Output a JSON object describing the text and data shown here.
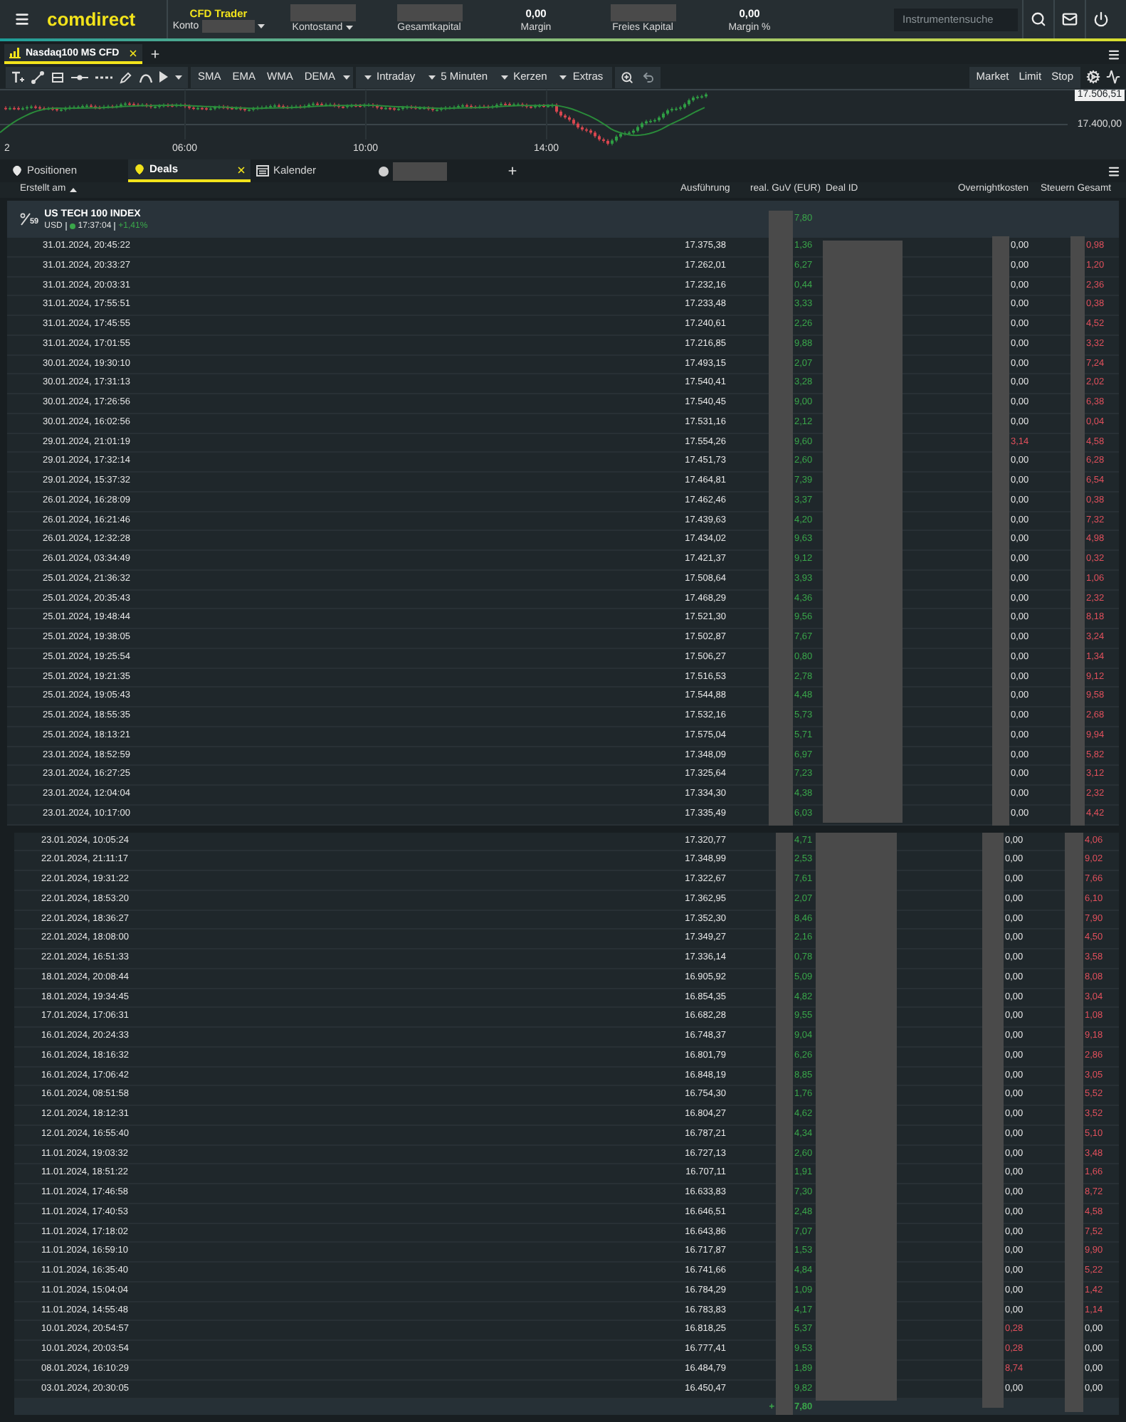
{
  "top_bar": {
    "logo": "comdirect",
    "account": {
      "product": "CFD Trader",
      "label": "Konto",
      "redacted": true
    },
    "stats": [
      {
        "label": "Kontostand",
        "redacted": true,
        "dropdown": true
      },
      {
        "label": "Gesamtkapital",
        "redacted": true,
        "dropdown": false
      },
      {
        "value": "0,00",
        "label": "Margin",
        "redacted": false,
        "dropdown": false
      },
      {
        "label": "Freies Kapital",
        "redacted": true,
        "dropdown": false
      },
      {
        "value": "0,00",
        "label": "Margin %",
        "redacted": false,
        "dropdown": false
      }
    ],
    "search": {
      "placeholder": "Instrumentensuche"
    }
  },
  "instrument_tabs": [
    {
      "label": "Nasdaq100 MS CFD",
      "selected": true,
      "closable": true
    }
  ],
  "toolbar": {
    "indicators": [
      "SMA",
      "EMA",
      "WMA",
      "DEMA"
    ],
    "dropdowns": [
      "Intraday",
      "5 Minuten",
      "Kerzen",
      "Extras"
    ],
    "order_types": [
      "Market",
      "Limit",
      "Stop"
    ]
  },
  "chart": {
    "price_tag": "17.506,51",
    "price_level": "17.400,00",
    "time_labels": [
      "2",
      "06:00",
      "10:00",
      "14:00"
    ]
  },
  "panel_tabs": [
    {
      "kind": "positions",
      "label": "Positionen",
      "selected": false,
      "closable": false
    },
    {
      "kind": "deals",
      "label": "Deals",
      "selected": true,
      "closable": true
    },
    {
      "kind": "calendar",
      "label": "Kalender",
      "selected": false,
      "closable": false
    },
    {
      "kind": "instrument",
      "redacted": true,
      "selected": false,
      "closable": false
    }
  ],
  "table": {
    "columns": [
      {
        "label": "Erstellt am",
        "sorted": true
      },
      {
        "label": "Ausführung",
        "sorted": false
      },
      {
        "label": "real. GuV (EUR)",
        "sorted": false
      },
      {
        "label": "Deal ID",
        "sorted": false
      },
      {
        "label": "Overnightkosten",
        "sorted": false
      },
      {
        "label": "Steuern Gesamt",
        "sorted": false
      }
    ],
    "group": {
      "badge": "59",
      "name": "US TECH 100 INDEX",
      "currency": "USD",
      "time": "17:37:04",
      "change": "+1,41%",
      "total": "7,80"
    },
    "sections": [
      {
        "redacted": true,
        "rows": [
          {
            "created": "31.01.2024, 20:45:22",
            "execution": "17.375,38",
            "pnl": "1,36",
            "overnight": "0,00",
            "overnight_debit": false,
            "taxes": "0,98",
            "taxes_debit": true
          },
          {
            "created": "31.01.2024, 20:33:27",
            "execution": "17.262,01",
            "pnl": "6,27",
            "overnight": "0,00",
            "overnight_debit": false,
            "taxes": "1,20",
            "taxes_debit": true
          },
          {
            "created": "31.01.2024, 20:03:31",
            "execution": "17.232,16",
            "pnl": "0,44",
            "overnight": "0,00",
            "overnight_debit": false,
            "taxes": "2,36",
            "taxes_debit": true
          },
          {
            "created": "31.01.2024, 17:55:51",
            "execution": "17.233,48",
            "pnl": "3,33",
            "overnight": "0,00",
            "overnight_debit": false,
            "taxes": "0,38",
            "taxes_debit": true
          },
          {
            "created": "31.01.2024, 17:45:55",
            "execution": "17.240,61",
            "pnl": "2,26",
            "overnight": "0,00",
            "overnight_debit": false,
            "taxes": "4,52",
            "taxes_debit": true
          },
          {
            "created": "31.01.2024, 17:01:55",
            "execution": "17.216,85",
            "pnl": "9,88",
            "overnight": "0,00",
            "overnight_debit": false,
            "taxes": "3,32",
            "taxes_debit": true
          },
          {
            "created": "30.01.2024, 19:30:10",
            "execution": "17.493,15",
            "pnl": "2,07",
            "overnight": "0,00",
            "overnight_debit": false,
            "taxes": "7,24",
            "taxes_debit": true
          },
          {
            "created": "30.01.2024, 17:31:13",
            "execution": "17.540,41",
            "pnl": "3,28",
            "overnight": "0,00",
            "overnight_debit": false,
            "taxes": "2,02",
            "taxes_debit": true
          },
          {
            "created": "30.01.2024, 17:26:56",
            "execution": "17.540,45",
            "pnl": "9,00",
            "overnight": "0,00",
            "overnight_debit": false,
            "taxes": "6,38",
            "taxes_debit": true
          },
          {
            "created": "30.01.2024, 16:02:56",
            "execution": "17.531,16",
            "pnl": "2,12",
            "overnight": "0,00",
            "overnight_debit": false,
            "taxes": "0,04",
            "taxes_debit": true
          },
          {
            "created": "29.01.2024, 21:01:19",
            "execution": "17.554,26",
            "pnl": "9,60",
            "overnight": "3,14",
            "overnight_debit": true,
            "taxes": "4,58",
            "taxes_debit": true
          },
          {
            "created": "29.01.2024, 17:32:14",
            "execution": "17.451,73",
            "pnl": "2,60",
            "overnight": "0,00",
            "overnight_debit": false,
            "taxes": "6,28",
            "taxes_debit": true
          },
          {
            "created": "29.01.2024, 15:37:32",
            "execution": "17.464,81",
            "pnl": "7,39",
            "overnight": "0,00",
            "overnight_debit": false,
            "taxes": "6,54",
            "taxes_debit": true
          },
          {
            "created": "26.01.2024, 16:28:09",
            "execution": "17.462,46",
            "pnl": "3,37",
            "overnight": "0,00",
            "overnight_debit": false,
            "taxes": "0,38",
            "taxes_debit": true
          },
          {
            "created": "26.01.2024, 16:21:46",
            "execution": "17.439,63",
            "pnl": "4,20",
            "overnight": "0,00",
            "overnight_debit": false,
            "taxes": "7,32",
            "taxes_debit": true
          },
          {
            "created": "26.01.2024, 12:32:28",
            "execution": "17.434,02",
            "pnl": "9,63",
            "overnight": "0,00",
            "overnight_debit": false,
            "taxes": "4,98",
            "taxes_debit": true
          },
          {
            "created": "26.01.2024, 03:34:49",
            "execution": "17.421,37",
            "pnl": "9,12",
            "overnight": "0,00",
            "overnight_debit": false,
            "taxes": "0,32",
            "taxes_debit": true
          },
          {
            "created": "25.01.2024, 21:36:32",
            "execution": "17.508,64",
            "pnl": "3,93",
            "overnight": "0,00",
            "overnight_debit": false,
            "taxes": "1,06",
            "taxes_debit": true
          },
          {
            "created": "25.01.2024, 20:35:43",
            "execution": "17.468,29",
            "pnl": "4,36",
            "overnight": "0,00",
            "overnight_debit": false,
            "taxes": "2,32",
            "taxes_debit": true
          },
          {
            "created": "25.01.2024, 19:48:44",
            "execution": "17.521,30",
            "pnl": "9,56",
            "overnight": "0,00",
            "overnight_debit": false,
            "taxes": "8,18",
            "taxes_debit": true
          },
          {
            "created": "25.01.2024, 19:38:05",
            "execution": "17.502,87",
            "pnl": "7,67",
            "overnight": "0,00",
            "overnight_debit": false,
            "taxes": "3,24",
            "taxes_debit": true
          },
          {
            "created": "25.01.2024, 19:25:54",
            "execution": "17.506,27",
            "pnl": "0,80",
            "overnight": "0,00",
            "overnight_debit": false,
            "taxes": "1,34",
            "taxes_debit": true
          },
          {
            "created": "25.01.2024, 19:21:35",
            "execution": "17.516,53",
            "pnl": "2,78",
            "overnight": "0,00",
            "overnight_debit": false,
            "taxes": "9,12",
            "taxes_debit": true
          },
          {
            "created": "25.01.2024, 19:05:43",
            "execution": "17.544,88",
            "pnl": "4,48",
            "overnight": "0,00",
            "overnight_debit": false,
            "taxes": "9,58",
            "taxes_debit": true
          },
          {
            "created": "25.01.2024, 18:55:35",
            "execution": "17.532,16",
            "pnl": "5,73",
            "overnight": "0,00",
            "overnight_debit": false,
            "taxes": "2,68",
            "taxes_debit": true
          },
          {
            "created": "25.01.2024, 18:13:21",
            "execution": "17.575,04",
            "pnl": "5,71",
            "overnight": "0,00",
            "overnight_debit": false,
            "taxes": "9,94",
            "taxes_debit": true
          },
          {
            "created": "23.01.2024, 18:52:59",
            "execution": "17.348,09",
            "pnl": "6,97",
            "overnight": "0,00",
            "overnight_debit": false,
            "taxes": "5,82",
            "taxes_debit": true
          },
          {
            "created": "23.01.2024, 16:27:25",
            "execution": "17.325,64",
            "pnl": "7,23",
            "overnight": "0,00",
            "overnight_debit": false,
            "taxes": "3,12",
            "taxes_debit": true
          },
          {
            "created": "23.01.2024, 12:04:04",
            "execution": "17.334,30",
            "pnl": "4,38",
            "overnight": "0,00",
            "overnight_debit": false,
            "taxes": "2,32",
            "taxes_debit": true
          },
          {
            "created": "23.01.2024, 10:17:00",
            "execution": "17.335,49",
            "pnl": "6,03",
            "overnight": "0,00",
            "overnight_debit": false,
            "taxes": "4,42",
            "taxes_debit": true
          }
        ]
      },
      {
        "redacted": true,
        "rows": [
          {
            "created": "23.01.2024, 10:05:24",
            "execution": "17.320,77",
            "pnl": "4,71",
            "overnight": "0,00",
            "overnight_debit": false,
            "taxes": "4,06",
            "taxes_debit": true
          },
          {
            "created": "22.01.2024, 21:11:17",
            "execution": "17.348,99",
            "pnl": "2,53",
            "overnight": "0,00",
            "overnight_debit": false,
            "taxes": "9,02",
            "taxes_debit": true
          },
          {
            "created": "22.01.2024, 19:31:22",
            "execution": "17.322,67",
            "pnl": "7,61",
            "overnight": "0,00",
            "overnight_debit": false,
            "taxes": "7,66",
            "taxes_debit": true
          },
          {
            "created": "22.01.2024, 18:53:20",
            "execution": "17.362,95",
            "pnl": "2,07",
            "overnight": "0,00",
            "overnight_debit": false,
            "taxes": "6,10",
            "taxes_debit": true
          },
          {
            "created": "22.01.2024, 18:36:27",
            "execution": "17.352,30",
            "pnl": "8,46",
            "overnight": "0,00",
            "overnight_debit": false,
            "taxes": "7,90",
            "taxes_debit": true
          },
          {
            "created": "22.01.2024, 18:08:00",
            "execution": "17.349,27",
            "pnl": "2,16",
            "overnight": "0,00",
            "overnight_debit": false,
            "taxes": "4,50",
            "taxes_debit": true
          },
          {
            "created": "22.01.2024, 16:51:33",
            "execution": "17.336,14",
            "pnl": "0,78",
            "overnight": "0,00",
            "overnight_debit": false,
            "taxes": "3,58",
            "taxes_debit": true
          },
          {
            "created": "18.01.2024, 20:08:44",
            "execution": "16.905,92",
            "pnl": "5,09",
            "overnight": "0,00",
            "overnight_debit": false,
            "taxes": "8,08",
            "taxes_debit": true
          },
          {
            "created": "18.01.2024, 19:34:45",
            "execution": "16.854,35",
            "pnl": "4,82",
            "overnight": "0,00",
            "overnight_debit": false,
            "taxes": "3,04",
            "taxes_debit": true
          },
          {
            "created": "17.01.2024, 17:06:31",
            "execution": "16.682,28",
            "pnl": "9,55",
            "overnight": "0,00",
            "overnight_debit": false,
            "taxes": "1,08",
            "taxes_debit": true
          },
          {
            "created": "16.01.2024, 20:24:33",
            "execution": "16.748,37",
            "pnl": "9,04",
            "overnight": "0,00",
            "overnight_debit": false,
            "taxes": "9,18",
            "taxes_debit": true
          },
          {
            "created": "16.01.2024, 18:16:32",
            "execution": "16.801,79",
            "pnl": "6,26",
            "overnight": "0,00",
            "overnight_debit": false,
            "taxes": "2,86",
            "taxes_debit": true
          },
          {
            "created": "16.01.2024, 17:06:42",
            "execution": "16.848,19",
            "pnl": "8,85",
            "overnight": "0,00",
            "overnight_debit": false,
            "taxes": "3,05",
            "taxes_debit": true
          },
          {
            "created": "16.01.2024, 08:51:58",
            "execution": "16.754,30",
            "pnl": "1,76",
            "overnight": "0,00",
            "overnight_debit": false,
            "taxes": "5,52",
            "taxes_debit": true
          },
          {
            "created": "12.01.2024, 18:12:31",
            "execution": "16.804,27",
            "pnl": "4,62",
            "overnight": "0,00",
            "overnight_debit": false,
            "taxes": "3,52",
            "taxes_debit": true
          },
          {
            "created": "12.01.2024, 16:55:40",
            "execution": "16.787,21",
            "pnl": "4,34",
            "overnight": "0,00",
            "overnight_debit": false,
            "taxes": "5,10",
            "taxes_debit": true
          },
          {
            "created": "11.01.2024, 19:03:32",
            "execution": "16.727,13",
            "pnl": "2,60",
            "overnight": "0,00",
            "overnight_debit": false,
            "taxes": "3,48",
            "taxes_debit": true
          },
          {
            "created": "11.01.2024, 18:51:22",
            "execution": "16.707,11",
            "pnl": "1,91",
            "overnight": "0,00",
            "overnight_debit": false,
            "taxes": "1,66",
            "taxes_debit": true
          },
          {
            "created": "11.01.2024, 17:46:58",
            "execution": "16.633,83",
            "pnl": "7,30",
            "overnight": "0,00",
            "overnight_debit": false,
            "taxes": "8,72",
            "taxes_debit": true
          },
          {
            "created": "11.01.2024, 17:40:53",
            "execution": "16.646,51",
            "pnl": "2,48",
            "overnight": "0,00",
            "overnight_debit": false,
            "taxes": "4,58",
            "taxes_debit": true
          },
          {
            "created": "11.01.2024, 17:18:02",
            "execution": "16.643,86",
            "pnl": "7,07",
            "overnight": "0,00",
            "overnight_debit": false,
            "taxes": "7,52",
            "taxes_debit": true
          },
          {
            "created": "11.01.2024, 16:59:10",
            "execution": "16.717,87",
            "pnl": "1,53",
            "overnight": "0,00",
            "overnight_debit": false,
            "taxes": "9,90",
            "taxes_debit": true
          },
          {
            "created": "11.01.2024, 16:35:40",
            "execution": "16.741,66",
            "pnl": "4,84",
            "overnight": "0,00",
            "overnight_debit": false,
            "taxes": "5,22",
            "taxes_debit": true
          },
          {
            "created": "11.01.2024, 15:04:04",
            "execution": "16.784,29",
            "pnl": "1,09",
            "overnight": "0,00",
            "overnight_debit": false,
            "taxes": "1,42",
            "taxes_debit": true
          },
          {
            "created": "11.01.2024, 14:55:48",
            "execution": "16.783,83",
            "pnl": "4,17",
            "overnight": "0,00",
            "overnight_debit": false,
            "taxes": "1,14",
            "taxes_debit": true
          },
          {
            "created": "10.01.2024, 20:54:57",
            "execution": "16.818,25",
            "pnl": "5,37",
            "overnight": "0,28",
            "overnight_debit": true,
            "taxes": "0,00",
            "taxes_debit": false
          },
          {
            "created": "10.01.2024, 20:03:54",
            "execution": "16.777,41",
            "pnl": "9,53",
            "overnight": "0,28",
            "overnight_debit": true,
            "taxes": "0,00",
            "taxes_debit": false
          },
          {
            "created": "08.01.2024, 16:10:29",
            "execution": "16.484,79",
            "pnl": "1,89",
            "overnight": "8,74",
            "overnight_debit": true,
            "taxes": "0,00",
            "taxes_debit": false
          },
          {
            "created": "03.01.2024, 20:30:05",
            "execution": "16.450,47",
            "pnl": "9,82",
            "overnight": "0,00",
            "overnight_debit": false,
            "taxes": "0,00",
            "taxes_debit": false
          }
        ]
      }
    ],
    "total": {
      "sign": "+",
      "value": "7,80"
    }
  }
}
